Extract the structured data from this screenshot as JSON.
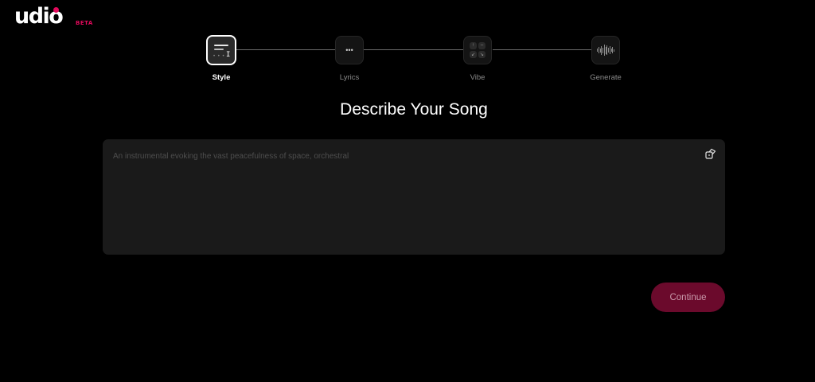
{
  "brand": {
    "logo_text": "udio",
    "beta_label": "BETA",
    "accent_color": "#e30a5c"
  },
  "stepper": {
    "steps": [
      {
        "label": "Style",
        "icon": "text-style-icon",
        "active": true
      },
      {
        "label": "Lyrics",
        "icon": "lyrics-dots-icon",
        "active": false
      },
      {
        "label": "Vibe",
        "icon": "vibe-grid-icon",
        "active": false
      },
      {
        "label": "Generate",
        "icon": "waveform-icon",
        "active": false
      }
    ]
  },
  "main": {
    "title": "Describe Your Song",
    "prompt_placeholder": "An instrumental evoking the vast peacefulness of space, orchestral",
    "prompt_value": "",
    "random_icon": "dice-icon"
  },
  "actions": {
    "continue_label": "Continue",
    "continue_color": "#6b0a2c"
  }
}
